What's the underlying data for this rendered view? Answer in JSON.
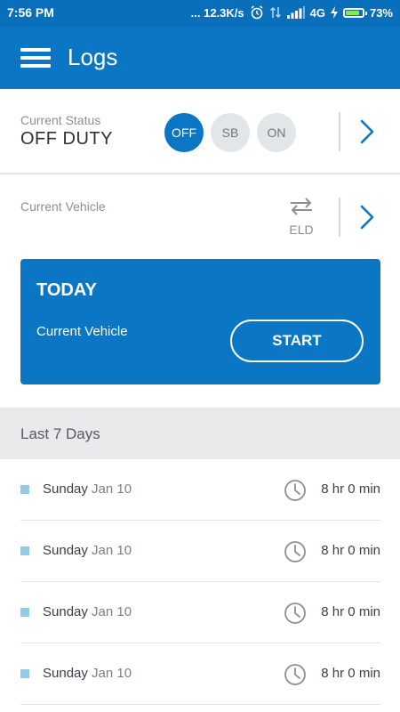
{
  "status_bar": {
    "time": "7:56 PM",
    "network_speed": "... 12.3K/s",
    "network_type": "4G",
    "battery": "73%",
    "icons": [
      "alarm-icon",
      "data-arrows-icon",
      "signal-icon",
      "charging-icon",
      "battery-icon"
    ]
  },
  "header": {
    "title": "Logs",
    "menu_icon": "hamburger-menu-icon"
  },
  "status": {
    "label": "Current Status",
    "value": "OFF DUTY",
    "options": [
      "OFF",
      "SB",
      "ON"
    ],
    "active": "OFF"
  },
  "vehicle": {
    "label": "Current Vehicle",
    "eld_label": "ELD",
    "eld_icon": "swap-arrows-icon"
  },
  "today": {
    "title": "TODAY",
    "vehicle_label": "Current Vehicle",
    "start_label": "START"
  },
  "last7": {
    "header": "Last 7 Days",
    "days": [
      {
        "day": "Sunday",
        "date": "Jan 10",
        "duration": "8 hr 0 min"
      },
      {
        "day": "Sunday",
        "date": "Jan 10",
        "duration": "8 hr 0 min"
      },
      {
        "day": "Sunday",
        "date": "Jan 10",
        "duration": "8 hr 0 min"
      },
      {
        "day": "Sunday",
        "date": "Jan 10",
        "duration": "8 hr 0 min"
      }
    ]
  },
  "colors": {
    "primary": "#0a76c4",
    "status_bar": "#0a6fbb",
    "pill_inactive": "#e3e6e8",
    "section_bg": "#e8eaeb",
    "bullet": "#93cbe6"
  }
}
